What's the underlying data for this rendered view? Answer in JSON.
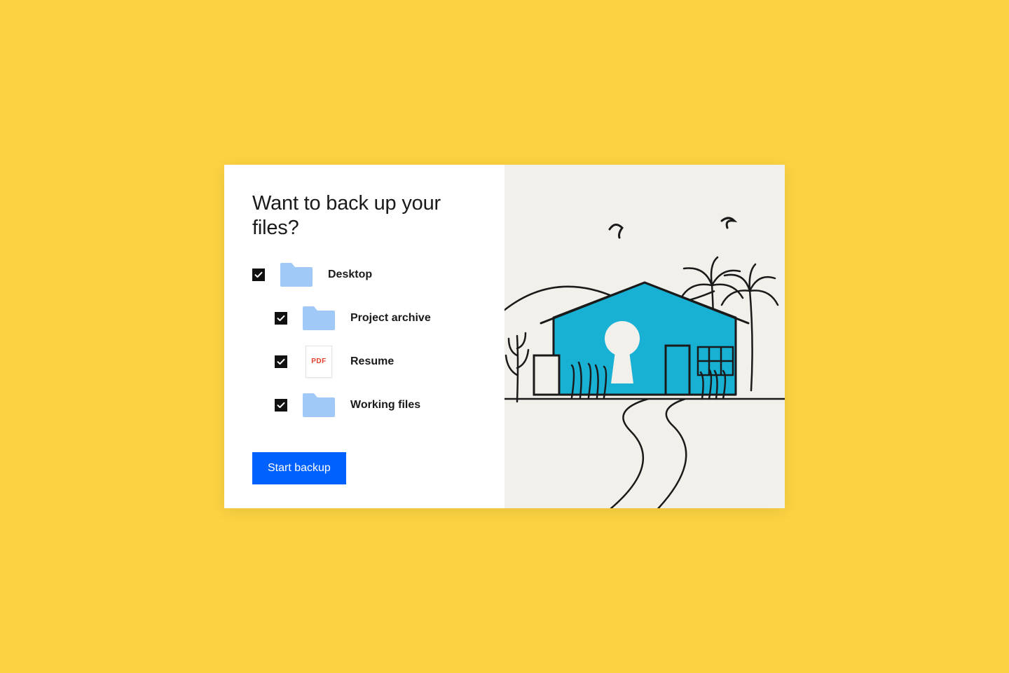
{
  "colors": {
    "page_bg": "#fbd241",
    "card_bg": "#ffffff",
    "illustration_bg": "#f2f0eb",
    "text": "#1a1a1a",
    "checkbox_fill": "#111111",
    "folder_fill": "#a1c9f7",
    "pdf_text": "#e43e2a",
    "button_bg": "#0061fe",
    "button_text": "#ffffff",
    "house_fill": "#18b1d3"
  },
  "title": "Want to back up your files?",
  "items": [
    {
      "checked": true,
      "indent": false,
      "icon": "folder",
      "label": "Desktop"
    },
    {
      "checked": true,
      "indent": true,
      "icon": "folder",
      "label": "Project archive"
    },
    {
      "checked": true,
      "indent": true,
      "icon": "pdf",
      "pdf_badge": "PDF",
      "label": "Resume"
    },
    {
      "checked": true,
      "indent": true,
      "icon": "folder",
      "label": "Working files"
    }
  ],
  "cta_label": "Start backup",
  "illustration": {
    "description": "Line-drawn house with keyhole, palm trees, hills, birds, winding path",
    "house_color": "#18b1d3"
  }
}
